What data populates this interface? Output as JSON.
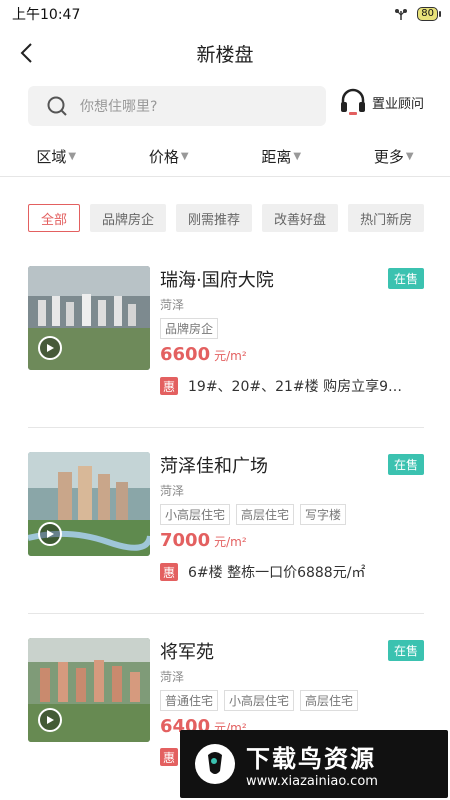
{
  "status_bar": {
    "time": "上午10:47",
    "battery": "80"
  },
  "nav": {
    "title": "新楼盘"
  },
  "search": {
    "placeholder": "你想住哪里?",
    "advisor_label": "置业顾问"
  },
  "filters": [
    "区域",
    "价格",
    "距离",
    "更多"
  ],
  "chips": [
    {
      "label": "全部",
      "active": true
    },
    {
      "label": "品牌房企",
      "active": false
    },
    {
      "label": "刚需推荐",
      "active": false
    },
    {
      "label": "改善好盘",
      "active": false
    },
    {
      "label": "热门新房",
      "active": false
    }
  ],
  "listings": [
    {
      "name": "瑞海·国府大院",
      "status": "在售",
      "district": "菏泽",
      "tags": [
        "品牌房企"
      ],
      "price": "6600",
      "unit": "元/m²",
      "promo_icon": "惠",
      "promo": "19#、20#、21#楼 购房立享9…"
    },
    {
      "name": "菏泽佳和广场",
      "status": "在售",
      "district": "菏泽",
      "tags": [
        "小高层住宅",
        "高层住宅",
        "写字楼"
      ],
      "price": "7000",
      "unit": "元/m²",
      "promo_icon": "惠",
      "promo": "6#楼 整栋一口价6888元/㎡"
    },
    {
      "name": "将军苑",
      "status": "在售",
      "district": "菏泽",
      "tags": [
        "普通住宅",
        "小高层住宅",
        "高层住宅"
      ],
      "price": "6400",
      "unit": "元/m²",
      "promo_icon": "惠",
      "promo": ""
    }
  ],
  "watermark": {
    "main": "下载鸟资源",
    "url": "www.xiazainiao.com"
  },
  "colors": {
    "accent": "#e36060",
    "status_badge": "#3bc2b0"
  }
}
